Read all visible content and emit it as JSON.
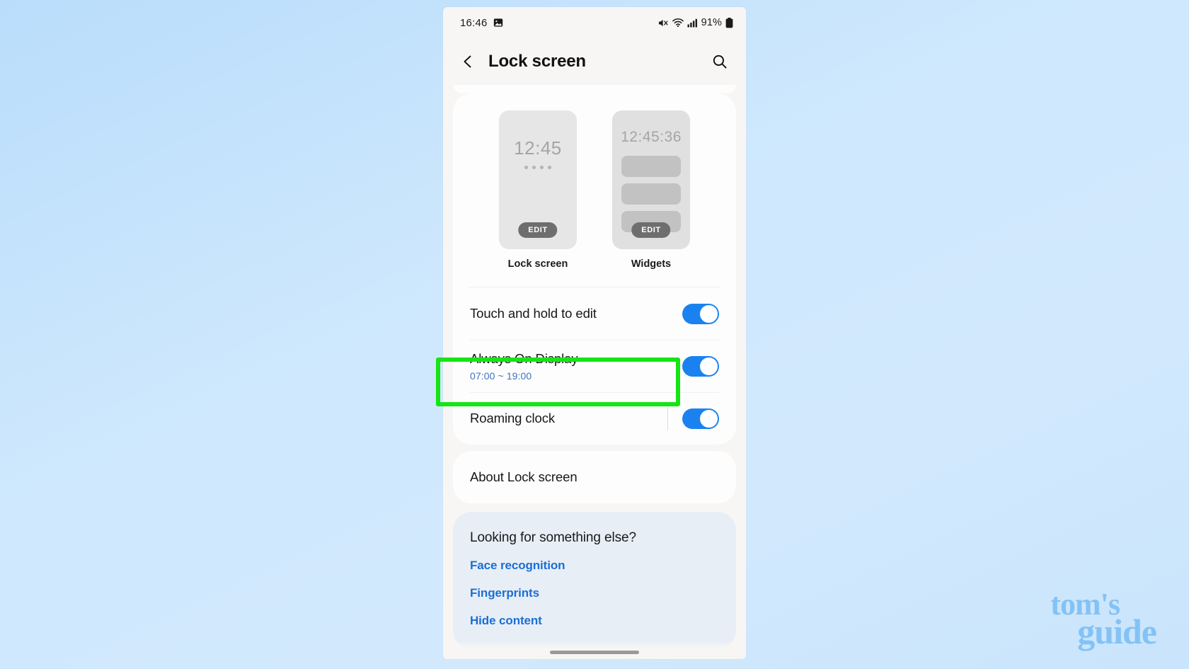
{
  "background": {
    "accent_green": "#15e515",
    "page_blue": "#cde5fa"
  },
  "watermark": {
    "line1": "tom's",
    "line2": "guide"
  },
  "phone": {
    "status_bar": {
      "time": "16:46",
      "left_icons": [
        "image-icon"
      ],
      "right_icons": [
        "mute-icon",
        "wifi-icon",
        "signal-icon"
      ],
      "battery_percent": "91%",
      "battery_icon": "battery-icon"
    },
    "app_bar": {
      "back_icon": "chevron-left-icon",
      "title": "Lock screen",
      "search_icon": "search-icon"
    },
    "previews": [
      {
        "id": "lock-screen",
        "label": "Lock screen",
        "clock": "12:45",
        "dots": 4,
        "edit_label": "EDIT"
      },
      {
        "id": "widgets",
        "label": "Widgets",
        "clock": "12:45:36",
        "bars": 3,
        "edit_label": "EDIT"
      }
    ],
    "settings_rows": [
      {
        "id": "touch-and-hold-to-edit",
        "title": "Touch and hold to edit",
        "subtitle": "",
        "toggle": "on",
        "divider_before_toggle": false,
        "highlighted": false
      },
      {
        "id": "always-on-display",
        "title": "Always On Display",
        "subtitle": "07:00 ~ 19:00",
        "toggle": "on",
        "divider_before_toggle": false,
        "highlighted": true
      },
      {
        "id": "roaming-clock",
        "title": "Roaming clock",
        "subtitle": "",
        "toggle": "on",
        "divider_before_toggle": true,
        "highlighted": false
      }
    ],
    "about_row": {
      "title": "About Lock screen"
    },
    "footer": {
      "heading": "Looking for something else?",
      "links": [
        {
          "label": "Face recognition"
        },
        {
          "label": "Fingerprints"
        },
        {
          "label": "Hide content"
        }
      ]
    }
  }
}
